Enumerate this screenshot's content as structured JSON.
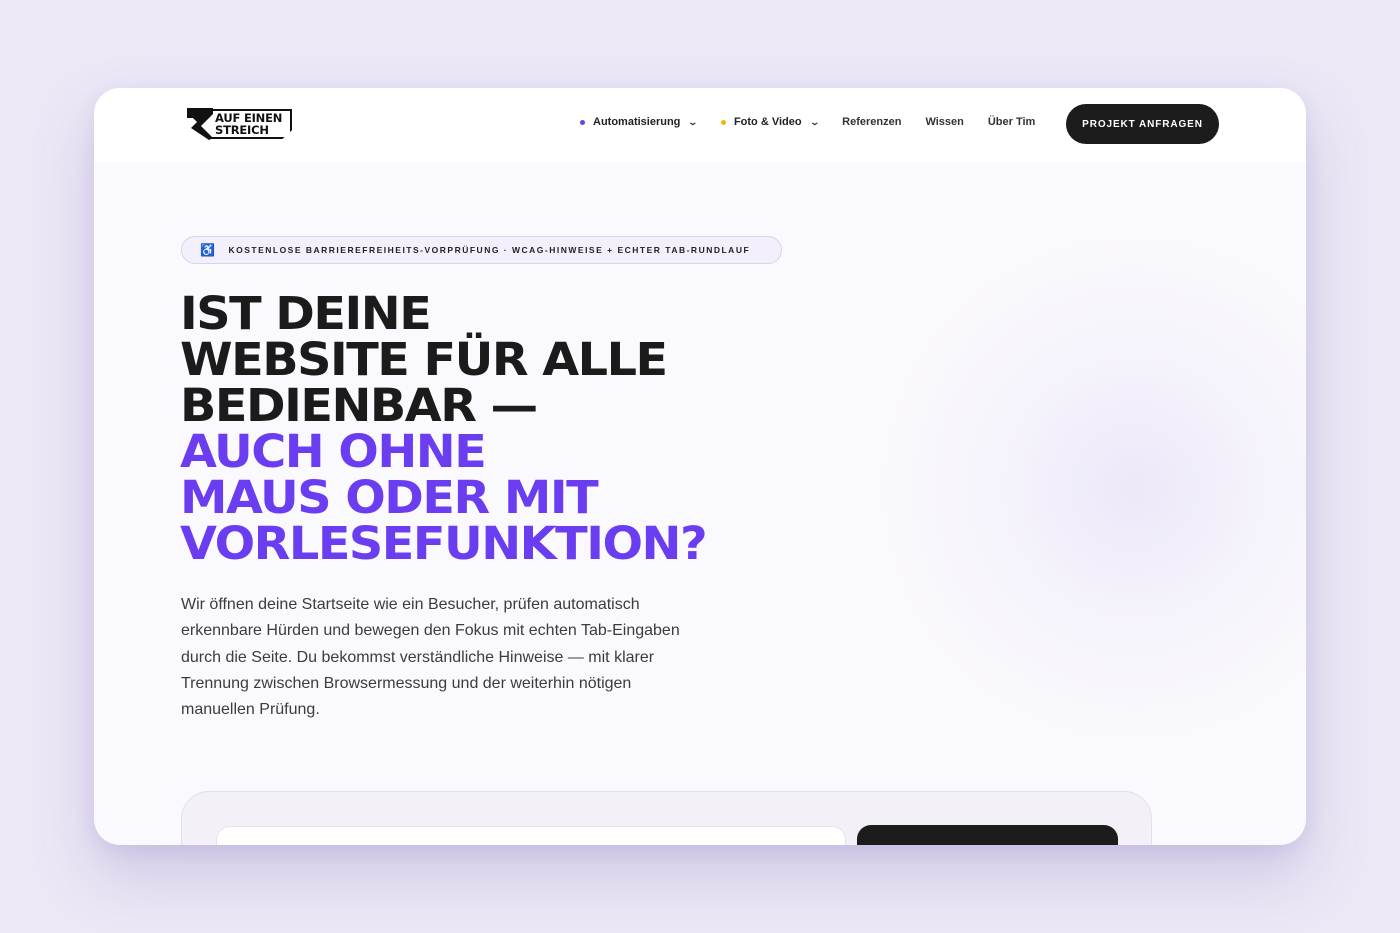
{
  "brand": {
    "logo_line1": "AUF EINEN",
    "logo_line2": "STREICH"
  },
  "nav": {
    "items": [
      {
        "label": "Automatisierung",
        "dot_color": "#6a3df0",
        "has_dropdown": true
      },
      {
        "label": "Foto & Video",
        "dot_color": "#f2b705",
        "has_dropdown": true
      },
      {
        "label": "Referenzen"
      },
      {
        "label": "Wissen"
      },
      {
        "label": "Über Tim"
      }
    ],
    "chevron": "⌄",
    "cta_label": "PROJEKT ANFRAGEN"
  },
  "hero": {
    "badge_icon": "accessibility-icon",
    "badge_text": "KOSTENLOSE BARRIEREFREIHEITS-VORPRÜFUNG · WCAG-HINWEISE + ECHTER TAB-RUNDLAUF",
    "headline_dark": [
      "IST DEINE",
      "WEBSITE FÜR ALLE",
      "BEDIENBAR —"
    ],
    "headline_accent": [
      "AUCH OHNE",
      "MAUS ODER MIT",
      "VORLESEFUNKTION?"
    ],
    "lead": "Wir öffnen deine Startseite wie ein Besucher, prüfen automatisch erkennbare Hürden und bewegen den Fokus mit echten Tab-Eingaben durch die Seite. Du bekommst verständliche Hinweise — mit klarer Trennung zwischen Browsermessung und der weiterhin nötigen manuellen Prüfung."
  },
  "colors": {
    "accent": "#6a3df0",
    "dark": "#1b1b1b",
    "page_bg": "#ece8f6"
  }
}
